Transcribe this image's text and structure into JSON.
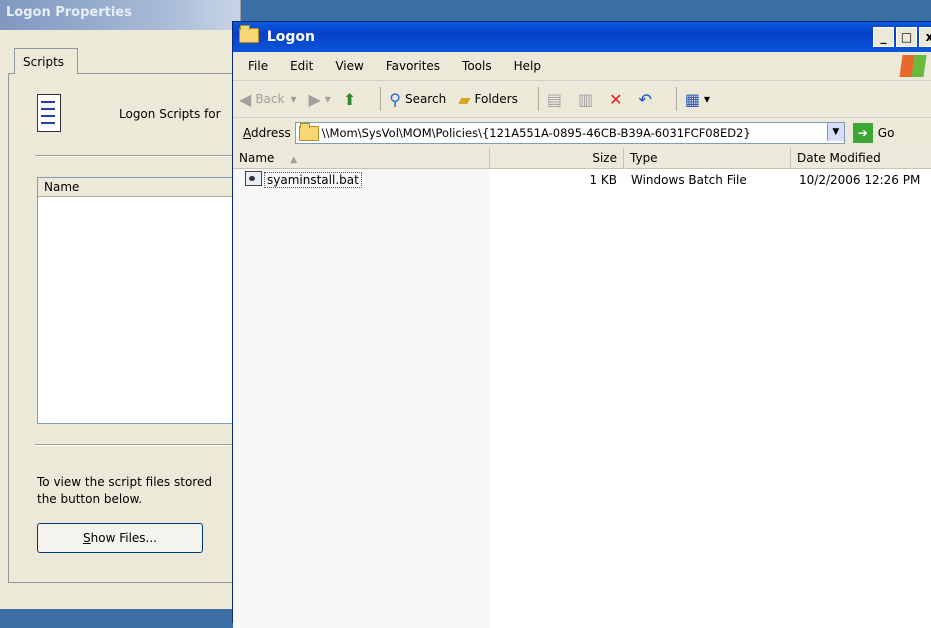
{
  "properties_dialog": {
    "title": "Logon Properties",
    "tab": "Scripts",
    "intro": "Logon Scripts for",
    "list_header": "Name",
    "footer_line1": "To view the script files stored",
    "footer_line2": "the button below.",
    "show_files_prefix": "S",
    "show_files_rest": "how Files..."
  },
  "explorer": {
    "title": "Logon",
    "window_controls": [
      "_",
      "□",
      "x"
    ],
    "menu": [
      "File",
      "Edit",
      "View",
      "Favorites",
      "Tools",
      "Help"
    ],
    "toolbar": {
      "back": "Back",
      "search": "Search",
      "folders": "Folders"
    },
    "address": {
      "label_prefix": "A",
      "label_rest": "ddress",
      "path": "\\\\Mom\\SysVol\\MOM\\Policies\\{121A551A-0895-46CB-B39A-6031FCF08ED2}",
      "go": "Go"
    },
    "columns": [
      "Name",
      "Size",
      "Type",
      "Date Modified"
    ],
    "files": [
      {
        "name": "syaminstall.bat",
        "size": "1 KB",
        "type": "Windows Batch File",
        "modified": "10/2/2006 12:26 PM"
      }
    ]
  },
  "colors": {
    "titlebar_active": "#0a58d8",
    "titlebar_inactive": "#7f98bf",
    "face": "#ece9d8"
  }
}
